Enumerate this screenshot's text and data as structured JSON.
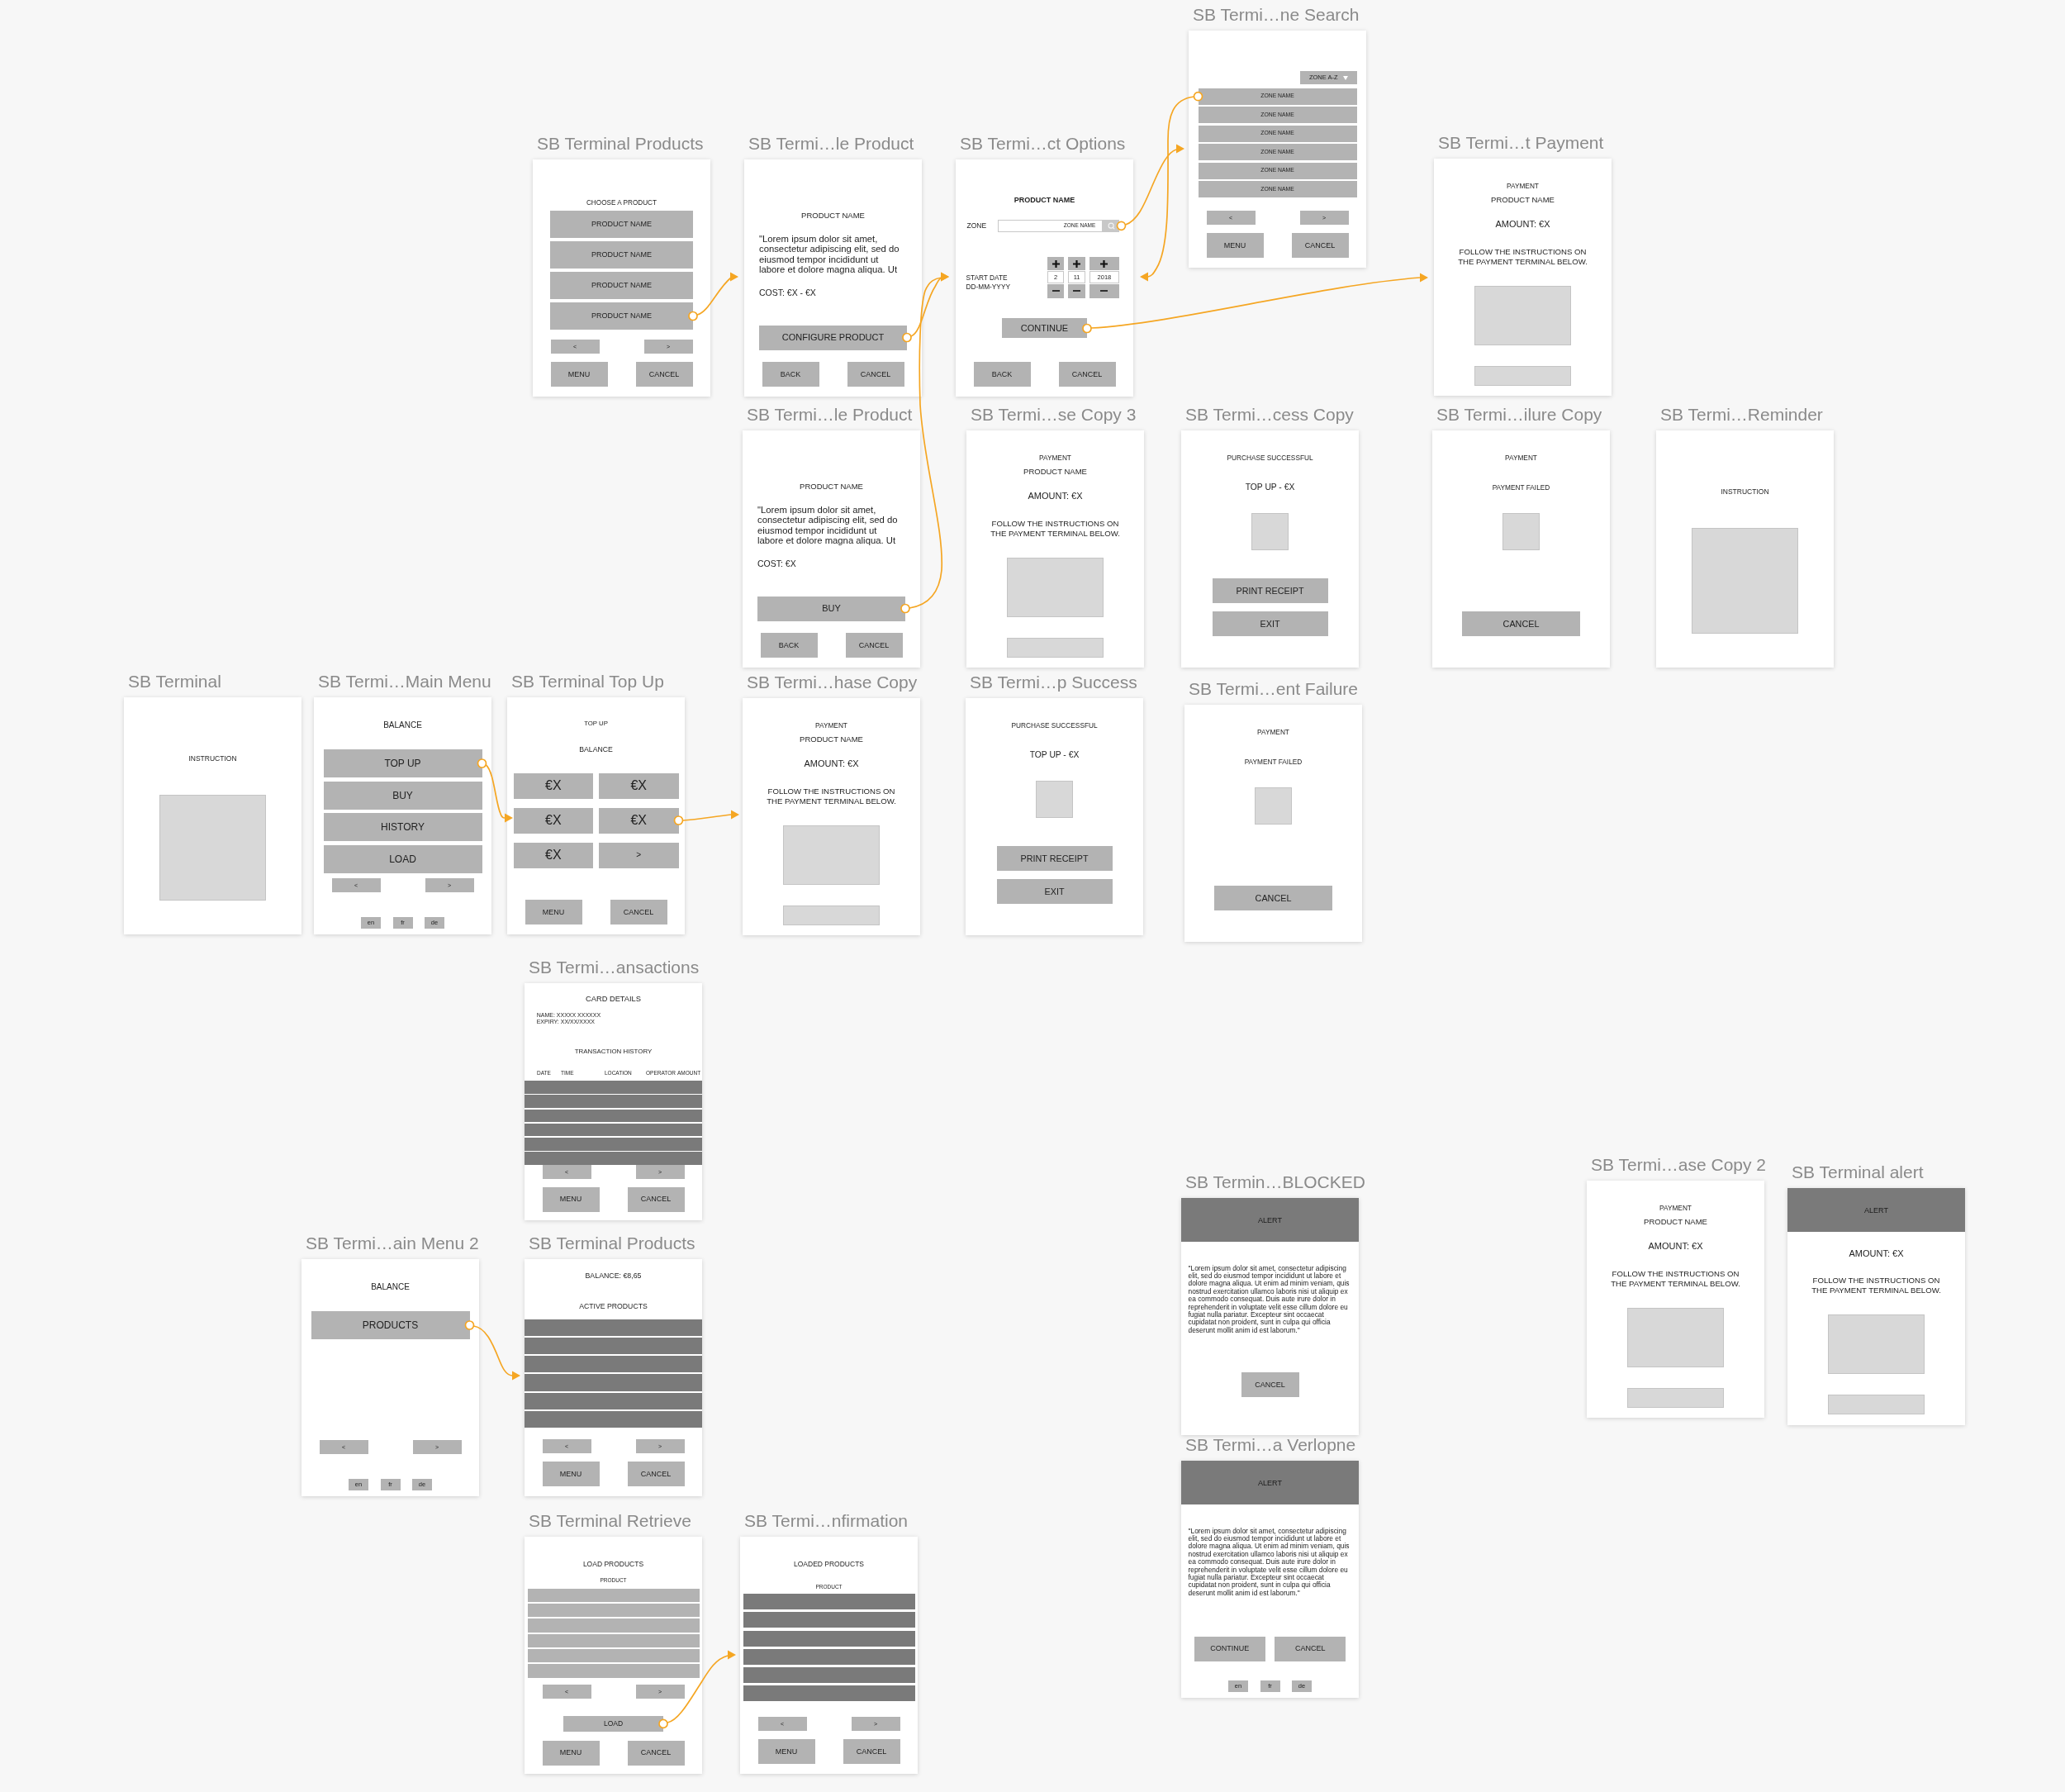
{
  "artboards": [
    {
      "title": "SB Termi…ne Search",
      "kind": "zone_search",
      "sort": "ZONE A-Z",
      "items": [
        "ZONE NAME",
        "ZONE NAME",
        "ZONE NAME",
        "ZONE NAME",
        "ZONE NAME",
        "ZONE NAME"
      ],
      "nav": [
        "<",
        ">"
      ],
      "actions": [
        "MENU",
        "CANCEL"
      ]
    },
    {
      "title": "SB Terminal Products",
      "kind": "product_list",
      "heading": "CHOOSE A PRODUCT",
      "items": [
        "PRODUCT NAME",
        "PRODUCT NAME",
        "PRODUCT NAME",
        "PRODUCT NAME"
      ],
      "nav": [
        "<",
        ">"
      ],
      "actions": [
        "MENU",
        "CANCEL"
      ]
    },
    {
      "title": "SB Termi…le Product",
      "kind": "product_detail",
      "heading": "PRODUCT NAME",
      "description": "\"Lorem ipsum dolor sit amet, consectetur adipiscing elit, sed do eiusmod tempor incididunt ut labore et dolore magna aliqua. Ut",
      "cost": "COST: €X - €X",
      "primary": "CONFIGURE PRODUCT",
      "actions": [
        "BACK",
        "CANCEL"
      ]
    },
    {
      "title": "SB Termi…ct Options",
      "kind": "product_options",
      "heading": "PRODUCT NAME",
      "zone_label": "ZONE",
      "zone_value": "ZONE NAME",
      "date_label": "START DATE",
      "date_format": "DD-MM-YYYY",
      "date_parts": [
        "2",
        "11",
        "2018"
      ],
      "primary": "CONTINUE",
      "actions": [
        "BACK",
        "CANCEL"
      ]
    },
    {
      "title": "SB Termi…t Payment",
      "kind": "payment",
      "caption": "PAYMENT",
      "product": "PRODUCT NAME",
      "amount": "AMOUNT: €X",
      "instructions": "FOLLOW THE INSTRUCTIONS ON THE PAYMENT TERMINAL BELOW."
    },
    {
      "title": "SB Termi…le Product",
      "kind": "product_detail",
      "heading": "PRODUCT NAME",
      "description": "\"Lorem ipsum dolor sit amet, consectetur adipiscing elit, sed do eiusmod tempor incididunt ut labore et dolore magna aliqua. Ut",
      "cost": "COST: €X",
      "primary": "BUY",
      "actions": [
        "BACK",
        "CANCEL"
      ]
    },
    {
      "title": "SB Termi…se Copy 3",
      "kind": "payment",
      "caption": "PAYMENT",
      "product": "PRODUCT NAME",
      "amount": "AMOUNT: €X",
      "instructions": "FOLLOW THE INSTRUCTIONS ON THE PAYMENT TERMINAL BELOW."
    },
    {
      "title": "SB Termi…cess Copy",
      "kind": "success",
      "caption": "PURCHASE SUCCESSFUL",
      "line": "TOP UP - €X",
      "buttons": [
        "PRINT RECEIPT",
        "EXIT"
      ]
    },
    {
      "title": "SB Termi…ilure Copy",
      "kind": "failure",
      "caption": "PAYMENT",
      "status": "PAYMENT FAILED",
      "buttons": [
        "CANCEL"
      ]
    },
    {
      "title": "SB Termi…Reminder",
      "kind": "instruction",
      "caption": "INSTRUCTION"
    },
    {
      "title": "SB Terminal",
      "kind": "instruction",
      "caption": "INSTRUCTION"
    },
    {
      "title": "SB Termi…Main Menu",
      "kind": "main_menu",
      "heading": "BALANCE",
      "items": [
        "TOP UP",
        "BUY",
        "HISTORY",
        "LOAD"
      ],
      "nav": [
        "<",
        ">"
      ],
      "languages": [
        "en",
        "fr",
        "de"
      ]
    },
    {
      "title": "SB Terminal Top Up",
      "kind": "top_up",
      "heading": "TOP UP",
      "subheading": "BALANCE",
      "options": [
        {
          "kind": "amount",
          "label": "€X"
        },
        {
          "kind": "amount",
          "label": "€X"
        },
        {
          "kind": "amount",
          "label": "€X"
        },
        {
          "kind": "amount",
          "label": "€X"
        },
        {
          "kind": "amount",
          "label": "€X"
        },
        {
          "kind": "next",
          "label": ">"
        }
      ],
      "actions": [
        "MENU",
        "CANCEL"
      ]
    },
    {
      "title": "SB Termi…hase Copy",
      "kind": "payment",
      "caption": "PAYMENT",
      "product": "PRODUCT NAME",
      "amount": "AMOUNT: €X",
      "instructions": "FOLLOW THE INSTRUCTIONS ON THE PAYMENT TERMINAL BELOW."
    },
    {
      "title": "SB Termi…p Success",
      "kind": "success",
      "caption": "PURCHASE SUCCESSFUL",
      "line": "TOP UP - €X",
      "buttons": [
        "PRINT RECEIPT",
        "EXIT"
      ]
    },
    {
      "title": "SB Termi…ent Failure",
      "kind": "failure",
      "caption": "PAYMENT",
      "status": "PAYMENT FAILED",
      "buttons": [
        "CANCEL"
      ]
    },
    {
      "title": "SB Termi…ansactions",
      "kind": "transactions",
      "heading": "CARD DETAILS",
      "details": [
        "NAME: XXXXX XXXXXX",
        "EXPIRY: XX/XX/XXXX"
      ],
      "subheading": "TRANSACTION HISTORY",
      "columns": [
        "DATE",
        "TIME",
        "LOCATION",
        "OPERATOR",
        "AMOUNT"
      ],
      "nav": [
        "<",
        ">"
      ],
      "actions": [
        "MENU",
        "CANCEL"
      ]
    },
    {
      "title": "SB Termin…BLOCKED",
      "kind": "alert_message",
      "header": "ALERT",
      "message": "\"Lorem ipsum dolor sit amet, consectetur adipiscing elit, sed do eiusmod tempor incididunt ut labore et dolore magna aliqua. Ut enim ad minim veniam, quis nostrud exercitation ullamco laboris nisi ut aliquip ex ea commodo consequat. Duis aute irure dolor in reprehenderit in voluptate velit esse cillum dolore eu fugiat nulla pariatur. Excepteur sint occaecat cupidatat non proident, sunt in culpa qui officia deserunt mollit anim id est laborum.\"",
      "buttons": [
        "CANCEL"
      ]
    },
    {
      "title": "SB Termi…ase Copy 2",
      "kind": "payment",
      "caption": "PAYMENT",
      "product": "PRODUCT NAME",
      "amount": "AMOUNT: €X",
      "instructions": "FOLLOW THE INSTRUCTIONS ON THE PAYMENT TERMINAL BELOW."
    },
    {
      "title": "SB Terminal alert",
      "kind": "payment",
      "header": "ALERT",
      "amount": "AMOUNT: €X",
      "instructions": "FOLLOW THE INSTRUCTIONS ON THE PAYMENT TERMINAL BELOW."
    },
    {
      "title": "SB Termi…ain Menu 2",
      "kind": "main_menu",
      "heading": "BALANCE",
      "items": [
        "PRODUCTS"
      ],
      "nav": [
        "<",
        ">"
      ],
      "languages": [
        "en",
        "fr",
        "de"
      ]
    },
    {
      "title": "SB Terminal Products",
      "kind": "active_products",
      "heading": "BALANCE: €8,65",
      "subheading": "ACTIVE PRODUCTS",
      "nav": [
        "<",
        ">"
      ],
      "actions": [
        "MENU",
        "CANCEL"
      ]
    },
    {
      "title": "SB Termi…a Verlopne",
      "kind": "alert_message",
      "header": "ALERT",
      "message": "\"Lorem ipsum dolor sit amet, consectetur adipiscing elit, sed do eiusmod tempor incididunt ut labore et dolore magna aliqua. Ut enim ad minim veniam, quis nostrud exercitation ullamco laboris nisi ut aliquip ex ea commodo consequat. Duis aute irure dolor in reprehenderit in voluptate velit esse cillum dolore eu fugiat nulla pariatur. Excepteur sint occaecat cupidatat non proident, sunt in culpa qui officia deserunt mollit anim id est laborum.\"",
      "buttons": [
        "CONTINUE",
        "CANCEL"
      ],
      "languages": [
        "en",
        "fr",
        "de"
      ]
    },
    {
      "title": "SB Terminal Retrieve",
      "kind": "retrieve",
      "heading": "LOAD PRODUCTS",
      "column": "PRODUCT",
      "nav": [
        "<",
        ">"
      ],
      "primary": "LOAD",
      "actions": [
        "MENU",
        "CANCEL"
      ]
    },
    {
      "title": "SB Termi…nfirmation",
      "kind": "loaded",
      "heading": "LOADED PRODUCTS",
      "column": "PRODUCT",
      "nav": [
        "<",
        ">"
      ],
      "actions": [
        "MENU",
        "CANCEL"
      ]
    }
  ]
}
